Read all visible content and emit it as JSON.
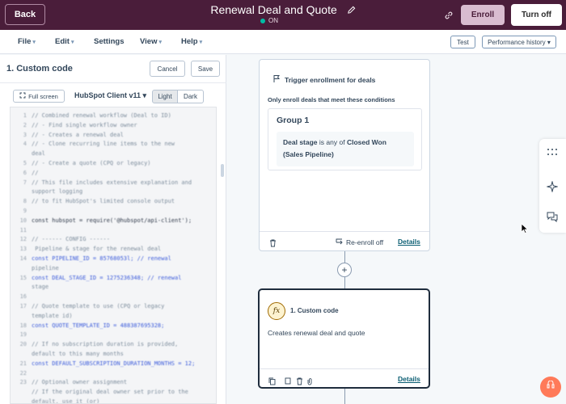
{
  "topbar": {
    "back_label": "Back",
    "title": "Renewal Deal and Quote",
    "status": "ON",
    "enroll_label": "Enroll",
    "turnoff_label": "Turn off"
  },
  "menu": {
    "file": "File",
    "edit": "Edit",
    "settings": "Settings",
    "view": "View",
    "help": "Help",
    "test": "Test",
    "performance": "Performance history"
  },
  "panel": {
    "title": "1. Custom code",
    "cancel": "Cancel",
    "save": "Save",
    "fullscreen": "Full screen",
    "client": "HubSpot Client v11",
    "theme_light": "Light",
    "theme_dark": "Dark"
  },
  "code": [
    {
      "n": "1",
      "t": "// Combined renewal workflow (Deal to ID)",
      "c": "comment"
    },
    {
      "n": "2",
      "t": "// - Find single workflow owner",
      "c": "comment"
    },
    {
      "n": "3",
      "t": "// - Creates a renewal deal",
      "c": "comment"
    },
    {
      "n": "4",
      "t": "// - Clone recurring line items to the new",
      "c": "comment"
    },
    {
      "n": "",
      "t": "deal",
      "c": "comment"
    },
    {
      "n": "5",
      "t": "// - Create a quote (CPQ or legacy)",
      "c": "comment"
    },
    {
      "n": "6",
      "t": "//",
      "c": "comment"
    },
    {
      "n": "7",
      "t": "// This file includes extensive explanation and",
      "c": "comment"
    },
    {
      "n": "",
      "t": "support logging",
      "c": "comment"
    },
    {
      "n": "8",
      "t": "// to fit HubSpot's limited console output",
      "c": "comment"
    },
    {
      "n": "9",
      "t": "",
      "c": "plain"
    },
    {
      "n": "10",
      "t": "const hubspot = require('@hubspot/api-client');",
      "c": "plain"
    },
    {
      "n": "11",
      "t": "",
      "c": "plain"
    },
    {
      "n": "12",
      "t": "// ------ CONFIG ------",
      "c": "comment"
    },
    {
      "n": "13",
      "t": "   Pipeline & stage for the renewal deal",
      "c": "comment"
    },
    {
      "n": "14",
      "t": "const PIPELINE_ID = 85768053l; // renewal",
      "c": "kw"
    },
    {
      "n": "",
      "t": "pipeline",
      "c": "comment"
    },
    {
      "n": "15",
      "t": "const DEAL_STAGE_ID = 1275236348; // renewal",
      "c": "kw"
    },
    {
      "n": "",
      "t": "stage",
      "c": "comment"
    },
    {
      "n": "16",
      "t": "",
      "c": "plain"
    },
    {
      "n": "17",
      "t": "// Quote template to use (CPQ or legacy",
      "c": "comment"
    },
    {
      "n": "",
      "t": "template id)",
      "c": "comment"
    },
    {
      "n": "18",
      "t": "const QUOTE_TEMPLATE_ID = 488387695328;",
      "c": "kw"
    },
    {
      "n": "19",
      "t": "",
      "c": "plain"
    },
    {
      "n": "20",
      "t": "// If no subscription duration is provided,",
      "c": "comment"
    },
    {
      "n": "",
      "t": "default to this many months",
      "c": "comment"
    },
    {
      "n": "21",
      "t": "const DEFAULT_SUBSCRIPTION_DURATION_MONTHS = 12;",
      "c": "kw"
    },
    {
      "n": "22",
      "t": "",
      "c": "plain"
    },
    {
      "n": "23",
      "t": "// Optional owner assignment",
      "c": "comment"
    },
    {
      "n": "",
      "t": "//   If the original deal owner set prior to the",
      "c": "comment"
    },
    {
      "n": "",
      "t": "default, use it (or)",
      "c": "comment"
    }
  ],
  "trigger": {
    "label": "Trigger enrollment for deals",
    "conditions": "Only enroll deals that meet these conditions",
    "group_title": "Group 1",
    "prop": "Deal stage",
    "op": "is any of",
    "value": "Closed Won (Sales Pipeline)",
    "reenroll": "Re-enroll off",
    "details": "Details"
  },
  "action": {
    "title": "1. Custom code",
    "description": "Creates renewal deal and quote",
    "details": "Details",
    "icon_label": "fx"
  },
  "colors": {
    "brand_topbar": "#4a1d3a",
    "enroll_bg": "#d9bcd0",
    "link": "#0b5e73",
    "help_fab": "#ff7a59"
  }
}
